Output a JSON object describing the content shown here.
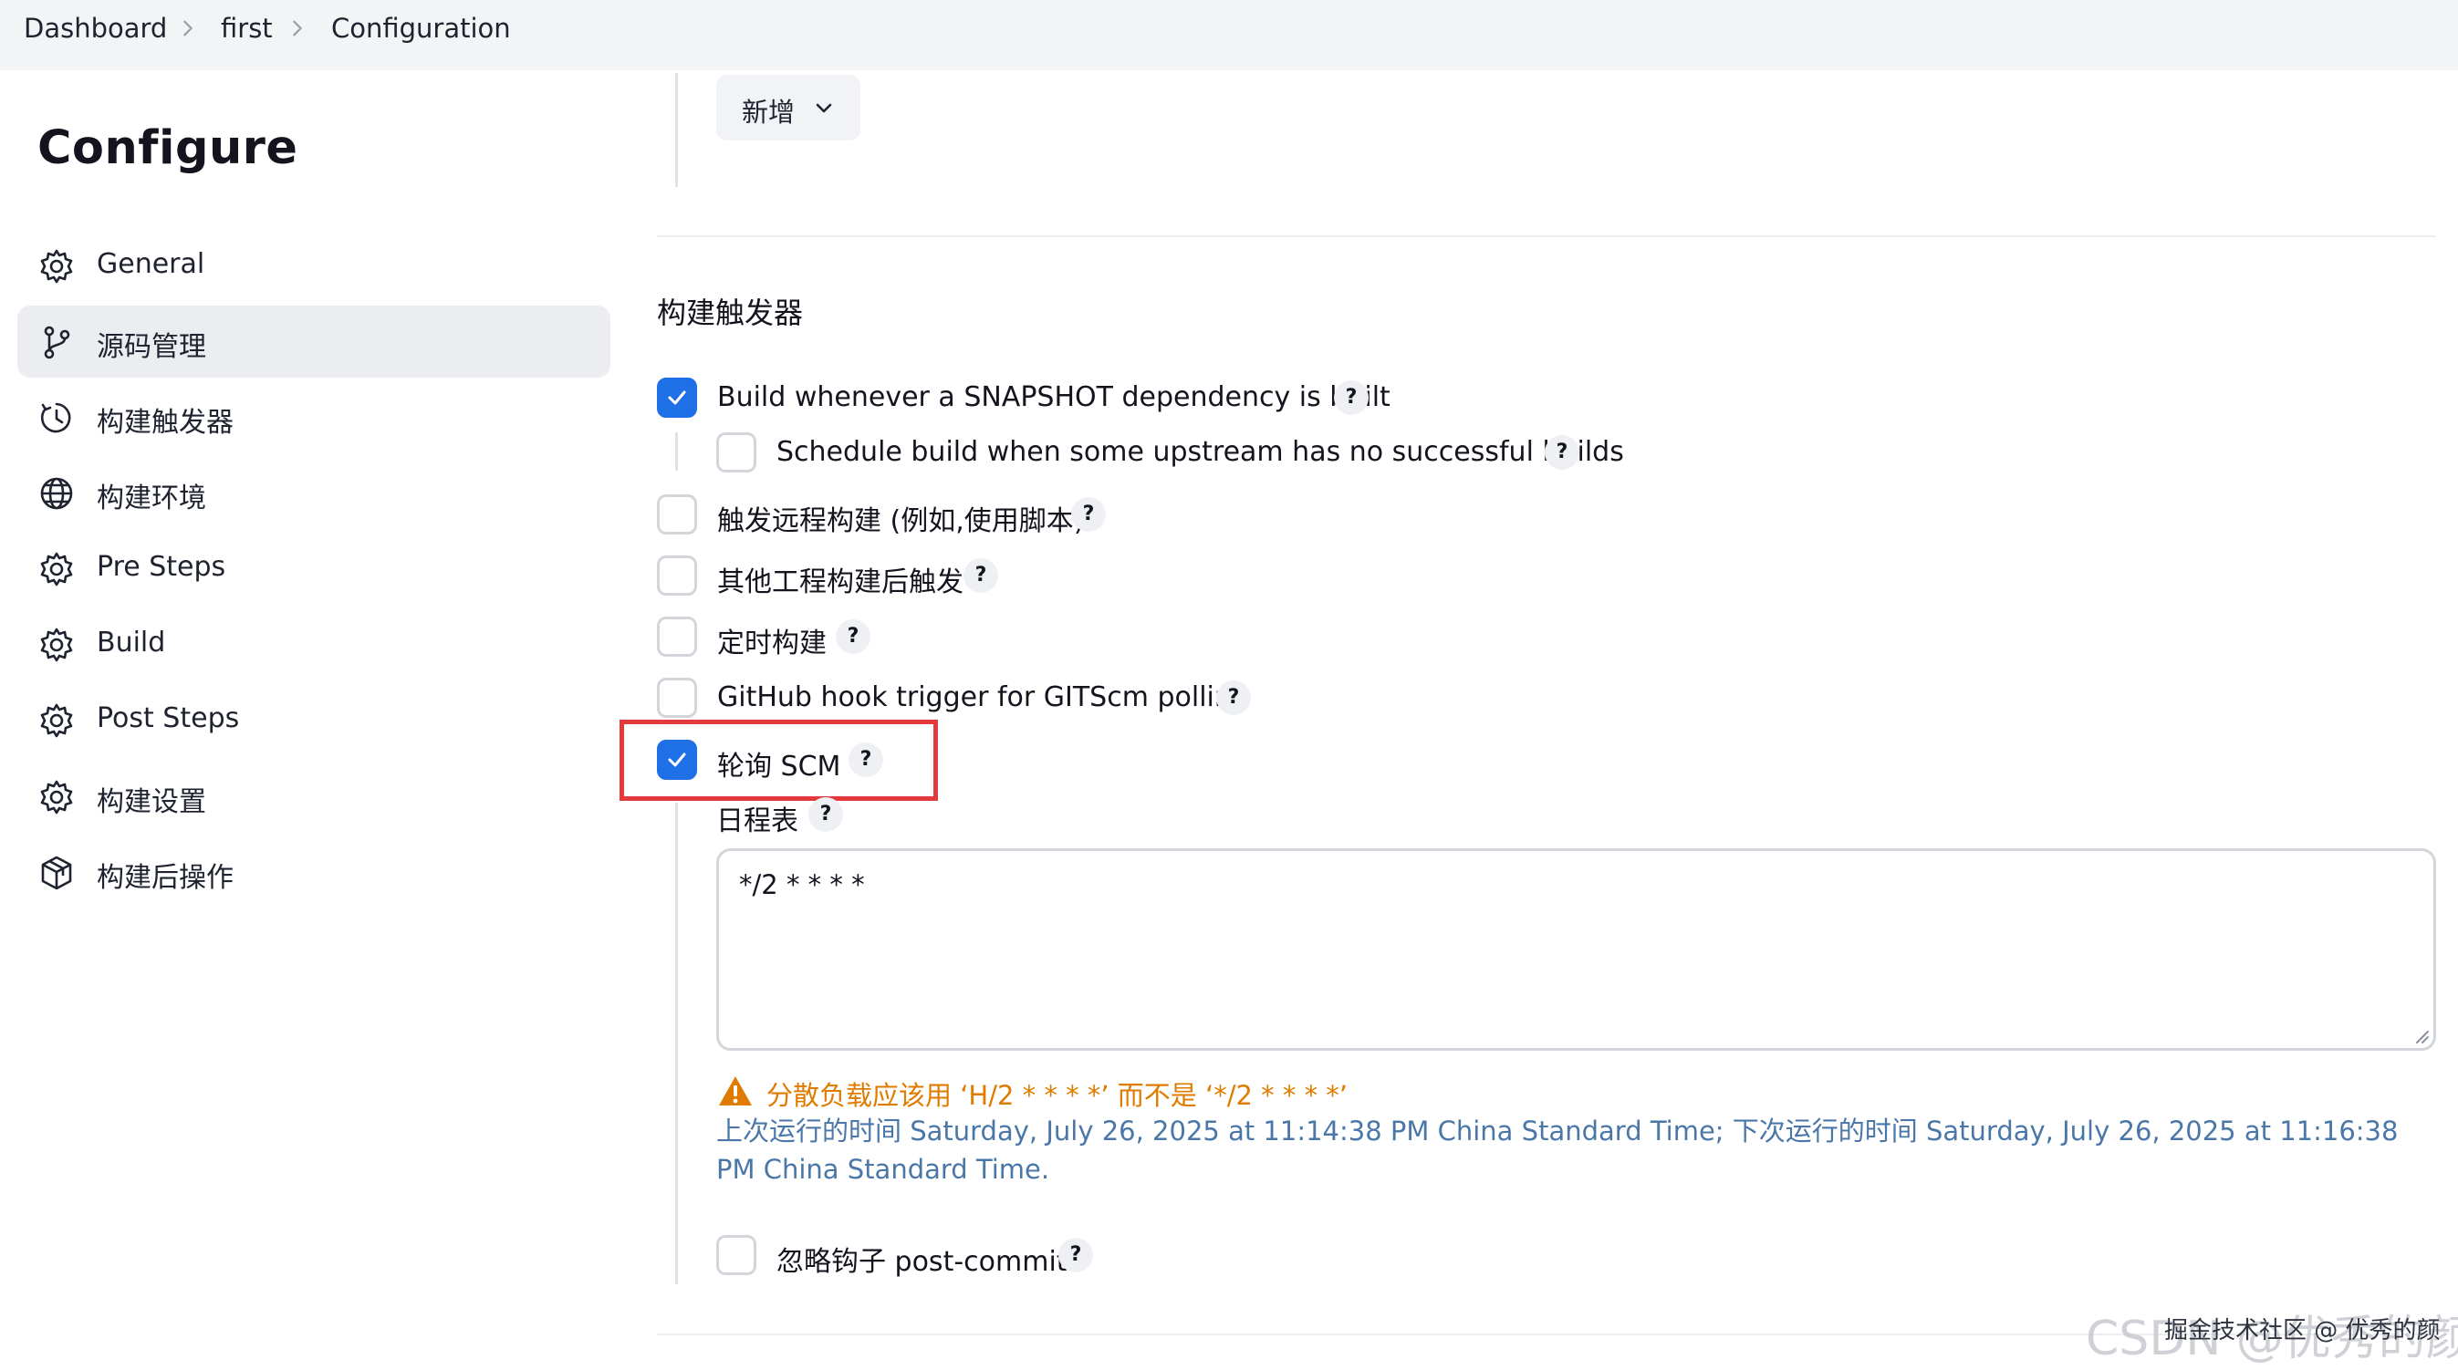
{
  "breadcrumb": {
    "items": [
      "Dashboard",
      "first",
      "Configuration"
    ]
  },
  "sidebar": {
    "title": "Configure",
    "items": [
      {
        "label": "General",
        "icon": "gear-icon"
      },
      {
        "label": "源码管理",
        "icon": "git-branch-icon",
        "active": true
      },
      {
        "label": "构建触发器",
        "icon": "clock-icon"
      },
      {
        "label": "构建环境",
        "icon": "globe-icon"
      },
      {
        "label": "Pre Steps",
        "icon": "gear-icon"
      },
      {
        "label": "Build",
        "icon": "gear-icon"
      },
      {
        "label": "Post Steps",
        "icon": "gear-icon"
      },
      {
        "label": "构建设置",
        "icon": "gear-icon"
      },
      {
        "label": "构建后操作",
        "icon": "cube-icon"
      }
    ]
  },
  "main": {
    "add_button": "新增",
    "section_title": "构建触发器",
    "options": [
      {
        "label": "Build whenever a SNAPSHOT dependency is built",
        "checked": true
      },
      {
        "label": "Schedule build when some upstream has no successful builds",
        "checked": false
      },
      {
        "label": "触发远程构建 (例如,使用脚本)",
        "checked": false
      },
      {
        "label": "其他工程构建后触发",
        "checked": false
      },
      {
        "label": "定时构建",
        "checked": false
      },
      {
        "label": "GitHub hook trigger for GITScm polling",
        "checked": false
      },
      {
        "label": "轮询 SCM",
        "checked": true
      }
    ],
    "schedule": {
      "label": "日程表",
      "value": "*/2 * * * *",
      "warning": "分散负载应该用 ‘H/2 * * * *’ 而不是 ‘*/2 * * * *’",
      "info": "上次运行的时间 Saturday, July 26, 2025 at 11:14:38 PM China Standard Time; 下次运行的时间 Saturday, July 26, 2025 at 11:16:38 PM China Standard Time."
    },
    "ignore_post_commit": {
      "label": "忽略钩子 post-commit",
      "checked": false
    },
    "help_symbol": "?"
  },
  "watermark": {
    "main": "CSDN @优秀的颜",
    "sub": "掘金技术社区 @ 优秀的颜"
  },
  "colors": {
    "accent": "#1f6fe6",
    "warning": "#e07b00",
    "info": "#4a77a8",
    "highlight": "#e23a3a"
  }
}
